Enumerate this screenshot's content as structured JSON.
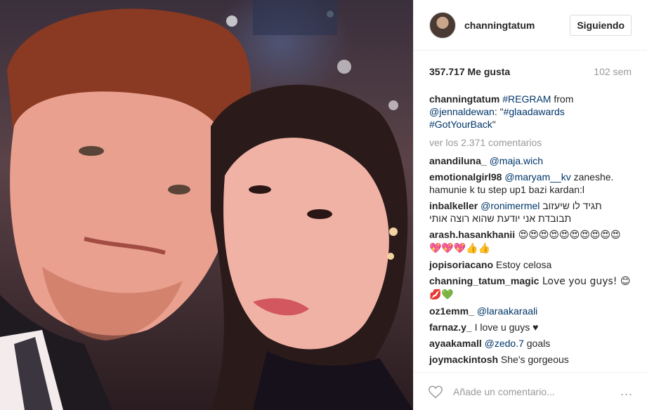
{
  "post": {
    "username": "channingtatum",
    "follow_label": "Siguiendo",
    "likes": "357.717 Me gusta",
    "age": "102 sem",
    "caption": {
      "user": "channingtatum",
      "tag1": "#REGRAM",
      "text1": " from",
      "mention": "@jennaldewan",
      "text2": ": \"",
      "tag2": "#glaadawards",
      "tag3": "#GotYourBack",
      "text3": "\""
    },
    "view_more": "ver los 2.371 comentarios",
    "comments": [
      {
        "user": "anandiluna_",
        "mention": "@maja.wich",
        "text": ""
      },
      {
        "user": "emotionalgirl98",
        "mention": "@maryam__kv",
        "text": " zaneshe. hamunie k tu step up1 bazi kardan:l"
      },
      {
        "user": "inbalkeller",
        "mention": "@ronimermel",
        "text": " תגיד לו שיעזוב תבובדת אני יודעת שהוא רוצה אותי"
      },
      {
        "user": "arash.hasankhanii",
        "mention": "",
        "text": " 😍😍😍😍😍😍😍😍😍😍💖💖💖👍👍"
      },
      {
        "user": "jopisoriacano",
        "mention": "",
        "text": " Estoy celosa"
      },
      {
        "user": "channing_tatum_magic",
        "mention": "",
        "text": " Love you guys! 😊💋💚"
      },
      {
        "user": "oz1emm_",
        "mention": "@laraakaraali",
        "text": ""
      },
      {
        "user": "farnaz.y_",
        "mention": "",
        "text": " I love u guys ♥"
      },
      {
        "user": "ayaakamall",
        "mention": "@zedo.7",
        "text": " goals"
      },
      {
        "user": "joymackintosh",
        "mention": "",
        "text": " She's gorgeous"
      }
    ],
    "comment_placeholder": "Añade un comentario...",
    "more_icon": "..."
  },
  "icons": {
    "heart": "heart-outline-icon",
    "more": "ellipsis-icon"
  },
  "colors": {
    "link": "#003569",
    "muted": "#999999",
    "border": "#efefef"
  }
}
